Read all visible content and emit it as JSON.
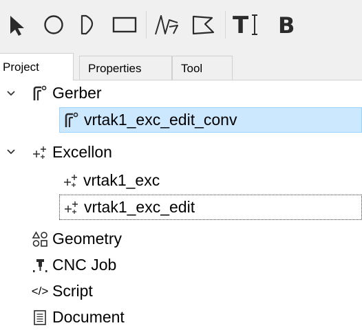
{
  "toolbar": {
    "tools": [
      {
        "icon": "pointer-arrow-icon"
      },
      {
        "icon": "circle-icon"
      },
      {
        "icon": "arc-icon"
      },
      {
        "icon": "rectangle-icon"
      },
      {
        "icon": "path-icon"
      },
      {
        "icon": "polygon-icon"
      },
      {
        "icon": "text-cursor-icon",
        "glyph": "T"
      },
      {
        "icon": "buffer-icon",
        "glyph": "B"
      }
    ]
  },
  "tabs": [
    {
      "label": "Project",
      "active": true
    },
    {
      "label": "Properties",
      "active": false
    },
    {
      "label": "Tool",
      "active": false
    }
  ],
  "tree": {
    "gerber": {
      "label": "Gerber",
      "expanded": true,
      "children": [
        {
          "label": "vrtak1_exc_edit_conv",
          "selected": true
        }
      ]
    },
    "excellon": {
      "label": "Excellon",
      "expanded": true,
      "children": [
        {
          "label": "vrtak1_exc",
          "selected": false
        },
        {
          "label": "vrtak1_exc_edit",
          "focused": true
        }
      ]
    },
    "geometry": {
      "label": "Geometry"
    },
    "cnc_job": {
      "label": "CNC Job"
    },
    "script": {
      "label": "Script",
      "glyph": "</>"
    },
    "document": {
      "label": "Document"
    }
  },
  "colors": {
    "selection_bg": "#cce8ff",
    "selection_border": "#99d1ff",
    "toolbar_bg": "#f0f0f0",
    "icon_dark": "#2b2b2b"
  }
}
